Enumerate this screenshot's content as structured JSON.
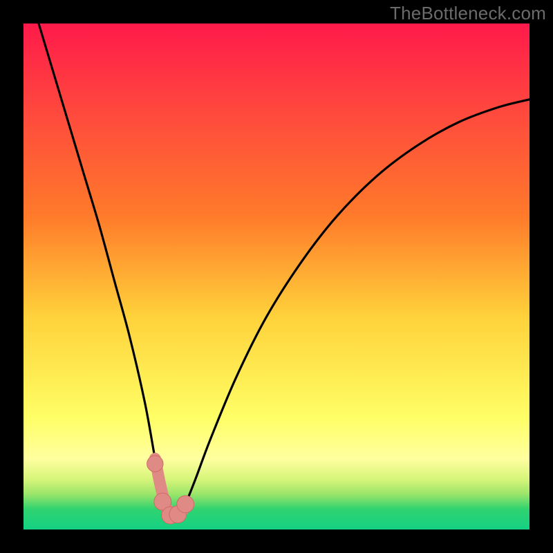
{
  "watermark": "TheBottleneck.com",
  "colors": {
    "black": "#000000",
    "curve": "#000000",
    "marker_fill": "#e08a86",
    "marker_stroke": "#cf6a66",
    "grad_top": "#ff1a4a",
    "grad_mid_upper": "#ff7a2a",
    "grad_mid": "#ffd23a",
    "grad_mid_lower": "#ffff66",
    "grad_yellow_band": "#ffffa0",
    "grad_green1": "#9be56a",
    "grad_green2": "#2fd36f",
    "grad_green3": "#18c778",
    "grad_bottom": "#14d184"
  },
  "chart_data": {
    "type": "line",
    "title": "",
    "xlabel": "",
    "ylabel": "",
    "xlim": [
      0,
      100
    ],
    "ylim": [
      0,
      100
    ],
    "series": [
      {
        "name": "bottleneck-curve",
        "x": [
          3,
          6,
          9,
          12,
          15,
          18,
          21,
          24,
          26,
          27,
          28,
          29,
          30,
          31,
          32,
          34,
          37,
          42,
          48,
          55,
          62,
          70,
          78,
          86,
          94,
          100
        ],
        "y": [
          100,
          90,
          80,
          70,
          60,
          49,
          38,
          25,
          14,
          9,
          5,
          3,
          2.5,
          3,
          5,
          10,
          18,
          30,
          42,
          53,
          62,
          70,
          76,
          80.5,
          83.5,
          85
        ]
      },
      {
        "name": "highlight-segment",
        "x": [
          26,
          27,
          28,
          29,
          30,
          31,
          32
        ],
        "y": [
          14,
          9,
          5,
          3,
          2.5,
          3,
          5
        ]
      }
    ],
    "markers": [
      {
        "x": 26.0,
        "y": 13.0,
        "r": 1.6
      },
      {
        "x": 27.5,
        "y": 5.5,
        "r": 1.7
      },
      {
        "x": 29.0,
        "y": 2.8,
        "r": 1.7
      },
      {
        "x": 30.5,
        "y": 3.0,
        "r": 1.7
      },
      {
        "x": 32.0,
        "y": 5.0,
        "r": 1.7
      }
    ]
  }
}
